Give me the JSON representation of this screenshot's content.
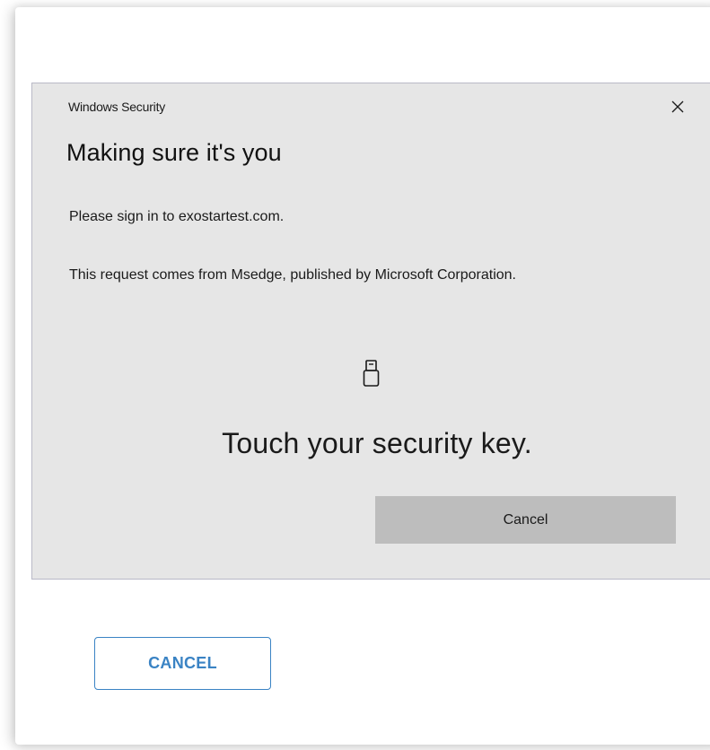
{
  "windows_security_dialog": {
    "title": "Windows Security",
    "heading": "Making sure it's you",
    "sign_in_message": "Please sign in to exostartest.com.",
    "request_message": "This request comes from Msedge, published by Microsoft Corporation.",
    "icon": "usb-security-key-icon",
    "instruction": "Touch your security key.",
    "cancel_label": "Cancel",
    "close_icon": "close-icon"
  },
  "web_page": {
    "cancel_label": "CANCEL",
    "accent_color": "#3a83c4"
  },
  "colors": {
    "dialog_background": "#e6e6e6",
    "dialog_button": "#bdbdbd",
    "web_button_border": "#3a83c4"
  }
}
